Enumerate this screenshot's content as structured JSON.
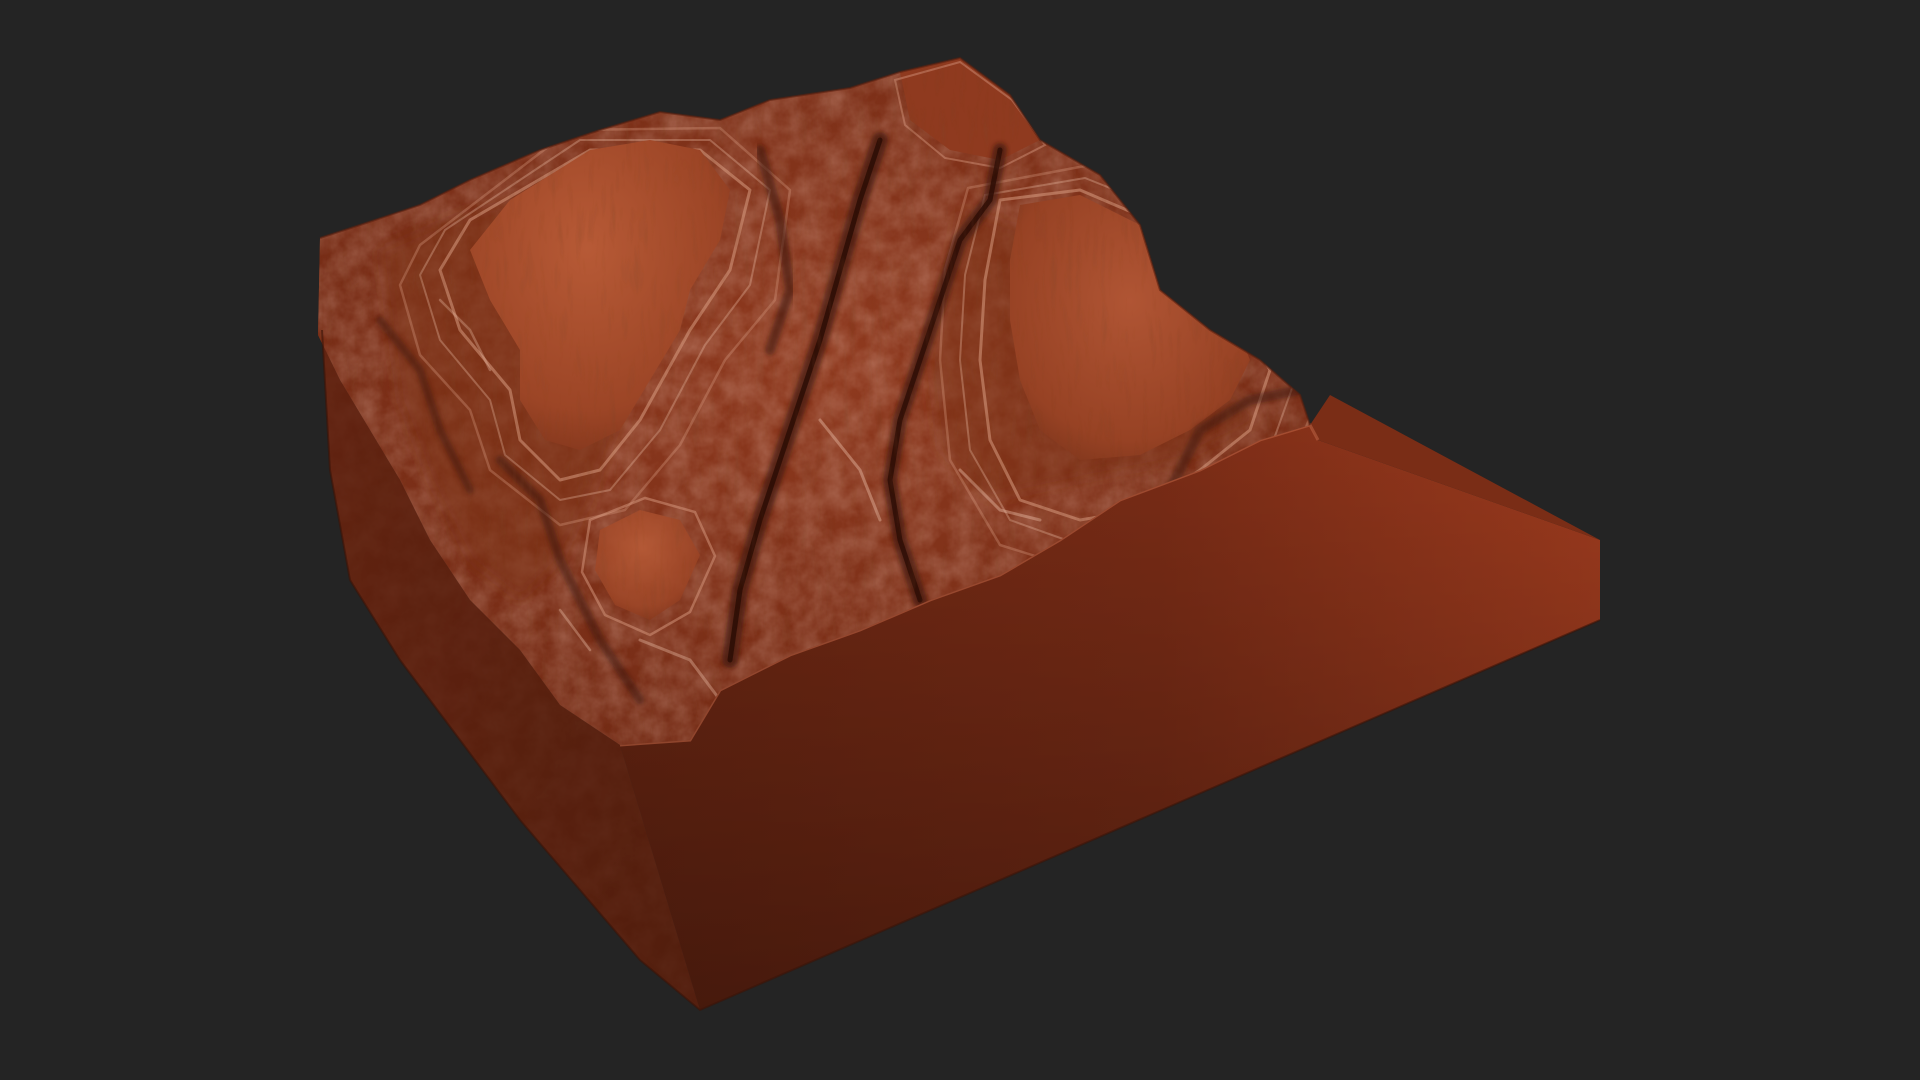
{
  "scene": {
    "subject": "terrain-block-model",
    "colors": {
      "background": "#242424",
      "side_light": "#9e3b1e",
      "side_mid": "#7a2c16",
      "side_dark": "#4a1a0c",
      "side_left": "#6e2713",
      "top_base": "#8f3a1f",
      "mesa_top": "#a04a2a",
      "mesa_highlight": "#b75a36",
      "canyon_shadow": "#3e1409",
      "strata_light": "#d79a80",
      "strata_pale": "#e7b9a2"
    }
  }
}
